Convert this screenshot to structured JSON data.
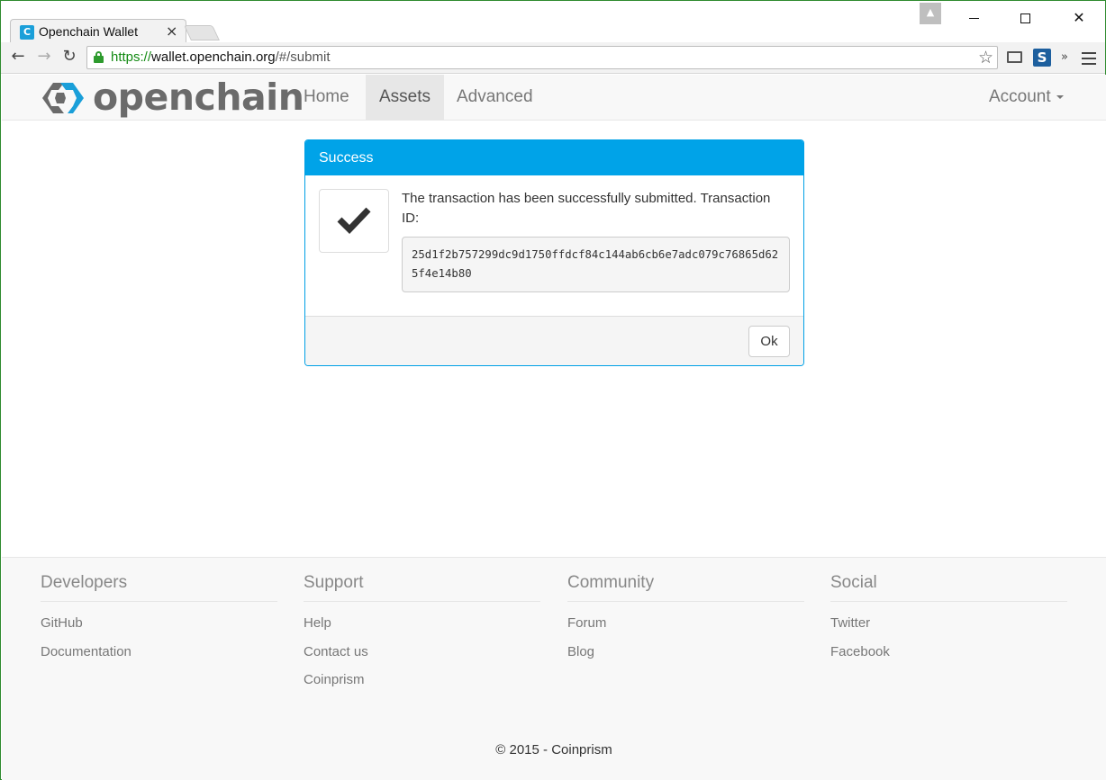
{
  "browser": {
    "tab_title": "Openchain Wallet",
    "tab_favicon_text": "C",
    "tab_close": "×",
    "url": {
      "scheme": "https://",
      "host": "wallet.openchain.org",
      "path": "/#/submit"
    },
    "extension_s": "S",
    "extensions_more": "»"
  },
  "navbar": {
    "brand": "openchain",
    "items": [
      {
        "label": "Home",
        "active": false
      },
      {
        "label": "Assets",
        "active": true
      },
      {
        "label": "Advanced",
        "active": false
      }
    ],
    "account_label": "Account"
  },
  "dialog": {
    "title": "Success",
    "message": "The transaction has been successfully submitted. Transaction ID:",
    "transaction_id": "25d1f2b757299dc9d1750ffdcf84c144ab6cb6e7adc079c76865d625f4e14b80",
    "ok_label": "Ok",
    "heading_color": "#00a3e8"
  },
  "footer": {
    "columns": [
      {
        "title": "Developers",
        "links": [
          "GitHub",
          "Documentation"
        ]
      },
      {
        "title": "Support",
        "links": [
          "Help",
          "Contact us",
          "Coinprism"
        ]
      },
      {
        "title": "Community",
        "links": [
          "Forum",
          "Blog"
        ]
      },
      {
        "title": "Social",
        "links": [
          "Twitter",
          "Facebook"
        ]
      }
    ],
    "copyright": "© 2015 - Coinprism"
  }
}
